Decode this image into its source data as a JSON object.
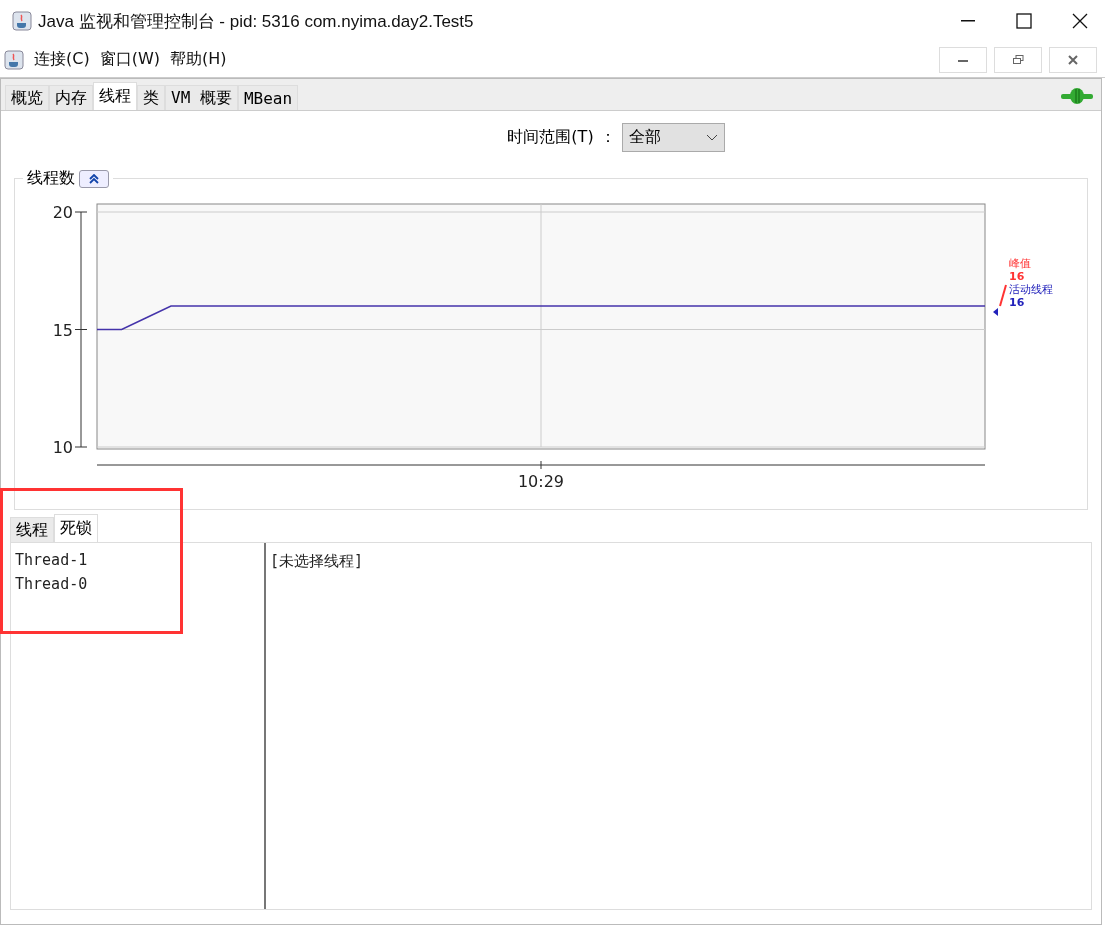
{
  "window": {
    "title": "Java 监视和管理控制台 - pid: 5316 com.nyima.day2.Test5"
  },
  "menu": [
    {
      "label": "连接(C)"
    },
    {
      "label": "窗口(W)"
    },
    {
      "label": "帮助(H)"
    }
  ],
  "tabs": [
    {
      "label": "概览",
      "selected": false
    },
    {
      "label": "内存",
      "selected": false
    },
    {
      "label": "线程",
      "selected": true
    },
    {
      "label": "类",
      "selected": false
    },
    {
      "label": "VM 概要",
      "selected": false
    },
    {
      "label": "MBean",
      "selected": false
    }
  ],
  "time_range": {
    "label": "时间范围(T)",
    "separator": "：",
    "value": "全部"
  },
  "chart_panel": {
    "title": "线程数",
    "expanded": true,
    "chart_data": {
      "type": "line",
      "ylim": [
        10,
        20
      ],
      "yticks": [
        10,
        15,
        20
      ],
      "series": [
        {
          "name": "活动线程",
          "color": "#4433aa",
          "values": [
            15,
            15,
            15.5,
            16,
            16,
            16,
            16,
            16,
            16,
            16,
            16,
            16,
            16,
            16,
            16,
            16,
            16,
            16,
            16,
            16,
            16,
            16,
            16,
            16,
            16,
            16,
            16,
            16,
            16,
            16,
            16,
            16,
            16,
            16,
            16,
            16,
            16
          ]
        }
      ],
      "annotations": [
        {
          "text": "10:29"
        }
      ]
    },
    "legend": [
      {
        "label": "峰值",
        "value": "16",
        "color": "#ff3333"
      },
      {
        "value": "16",
        "color": "#2222bb"
      }
    ]
  },
  "lower_tabs": [
    {
      "label": "线程",
      "selected": false
    },
    {
      "label": "死锁",
      "selected": true
    }
  ],
  "threads": [
    "Thread-1",
    "Thread-0"
  ],
  "detail": "[未选择线程]",
  "highlight_frame": {
    "shown": true,
    "color": "#ff3333"
  }
}
